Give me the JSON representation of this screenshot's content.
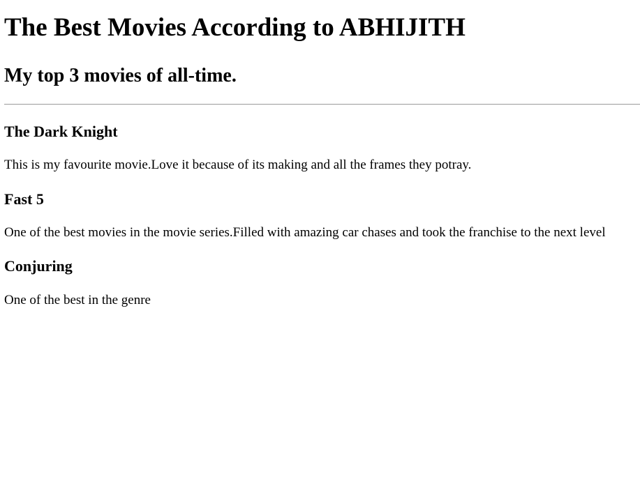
{
  "page": {
    "heading": "The Best Movies According to ABHIJITH",
    "subheading": "My top 3 movies of all-time."
  },
  "movies": [
    {
      "title": "The Dark Knight",
      "description": "This is my favourite movie.Love it because of its making and all the frames they potray."
    },
    {
      "title": "Fast 5",
      "description": "One of the best movies in the movie series.Filled with amazing car chases and took the franchise to the next level"
    },
    {
      "title": "Conjuring",
      "description": "One of the best in the genre"
    }
  ]
}
